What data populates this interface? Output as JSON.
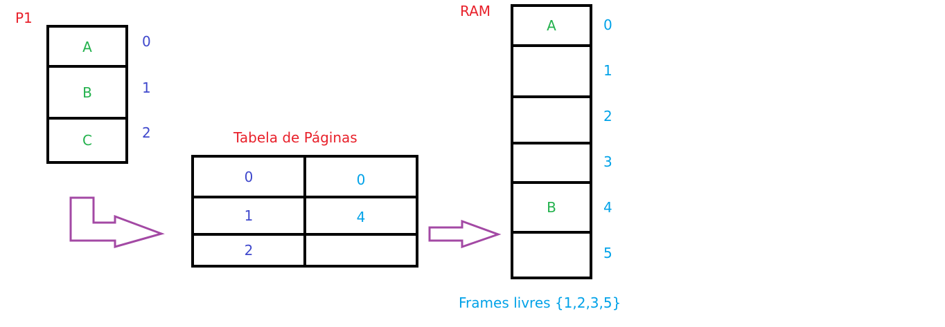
{
  "process": {
    "title": "P1",
    "pages": [
      {
        "content": "A",
        "index": "0"
      },
      {
        "content": "B",
        "index": "1"
      },
      {
        "content": "C",
        "index": "2"
      }
    ]
  },
  "page_table": {
    "title": "Tabela de Páginas",
    "rows": [
      {
        "page": "0",
        "frame": "0"
      },
      {
        "page": "1",
        "frame": "4"
      },
      {
        "page": "2",
        "frame": ""
      }
    ]
  },
  "ram": {
    "title": "RAM",
    "frames": [
      {
        "content": "A",
        "index": "0"
      },
      {
        "content": "",
        "index": "1"
      },
      {
        "content": "",
        "index": "2"
      },
      {
        "content": "",
        "index": "3"
      },
      {
        "content": "B",
        "index": "4"
      },
      {
        "content": "",
        "index": "5"
      }
    ],
    "free_frames_text": "Frames livres {1,2,3,5}"
  },
  "colors": {
    "title_red": "#e8202a",
    "content_green": "#22b14c",
    "index_navy": "#3f48cc",
    "frame_cyan": "#00a2e8",
    "arrow_purple": "#a349a4"
  }
}
